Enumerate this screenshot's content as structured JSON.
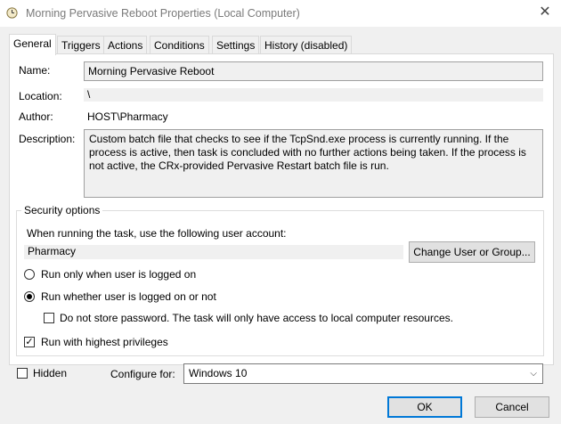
{
  "window": {
    "title": "Morning Pervasive Reboot Properties (Local Computer)",
    "close_glyph": "✕"
  },
  "tabs": [
    {
      "label": "General",
      "active": true
    },
    {
      "label": "Triggers"
    },
    {
      "label": "Actions"
    },
    {
      "label": "Conditions"
    },
    {
      "label": "Settings"
    },
    {
      "label": "History (disabled)"
    }
  ],
  "general": {
    "name_label": "Name:",
    "name_value": "Morning Pervasive Reboot",
    "location_label": "Location:",
    "location_value": "\\",
    "author_label": "Author:",
    "author_value": "HOST\\Pharmacy",
    "description_label": "Description:",
    "description_value": "Custom batch file that checks to see if the TcpSnd.exe process is currently running.  If the process is active, then task is concluded with no further actions being taken.  If the process is not active, the CRx-provided Pervasive Restart batch file is run."
  },
  "security": {
    "group_title": "Security options",
    "account_prompt": "When running the task, use the following user account:",
    "account_value": "Pharmacy",
    "change_user_label": "Change User or Group...",
    "radio_logged_on": "Run only when user is logged on",
    "radio_whether": "Run whether user is logged on or not",
    "no_store_password": "Do not store password.  The task will only have access to local computer resources.",
    "highest_privileges": "Run with highest privileges",
    "selected_radio": "whether",
    "highest_privileges_checked": true,
    "no_store_password_checked": false
  },
  "footer": {
    "hidden_label": "Hidden",
    "hidden_checked": false,
    "configure_label": "Configure for:",
    "configure_value": "Windows 10",
    "ok_label": "OK",
    "cancel_label": "Cancel"
  },
  "colors": {
    "accent": "#0078d7",
    "panel": "#ffffff",
    "dialog": "#f0f0f0"
  }
}
